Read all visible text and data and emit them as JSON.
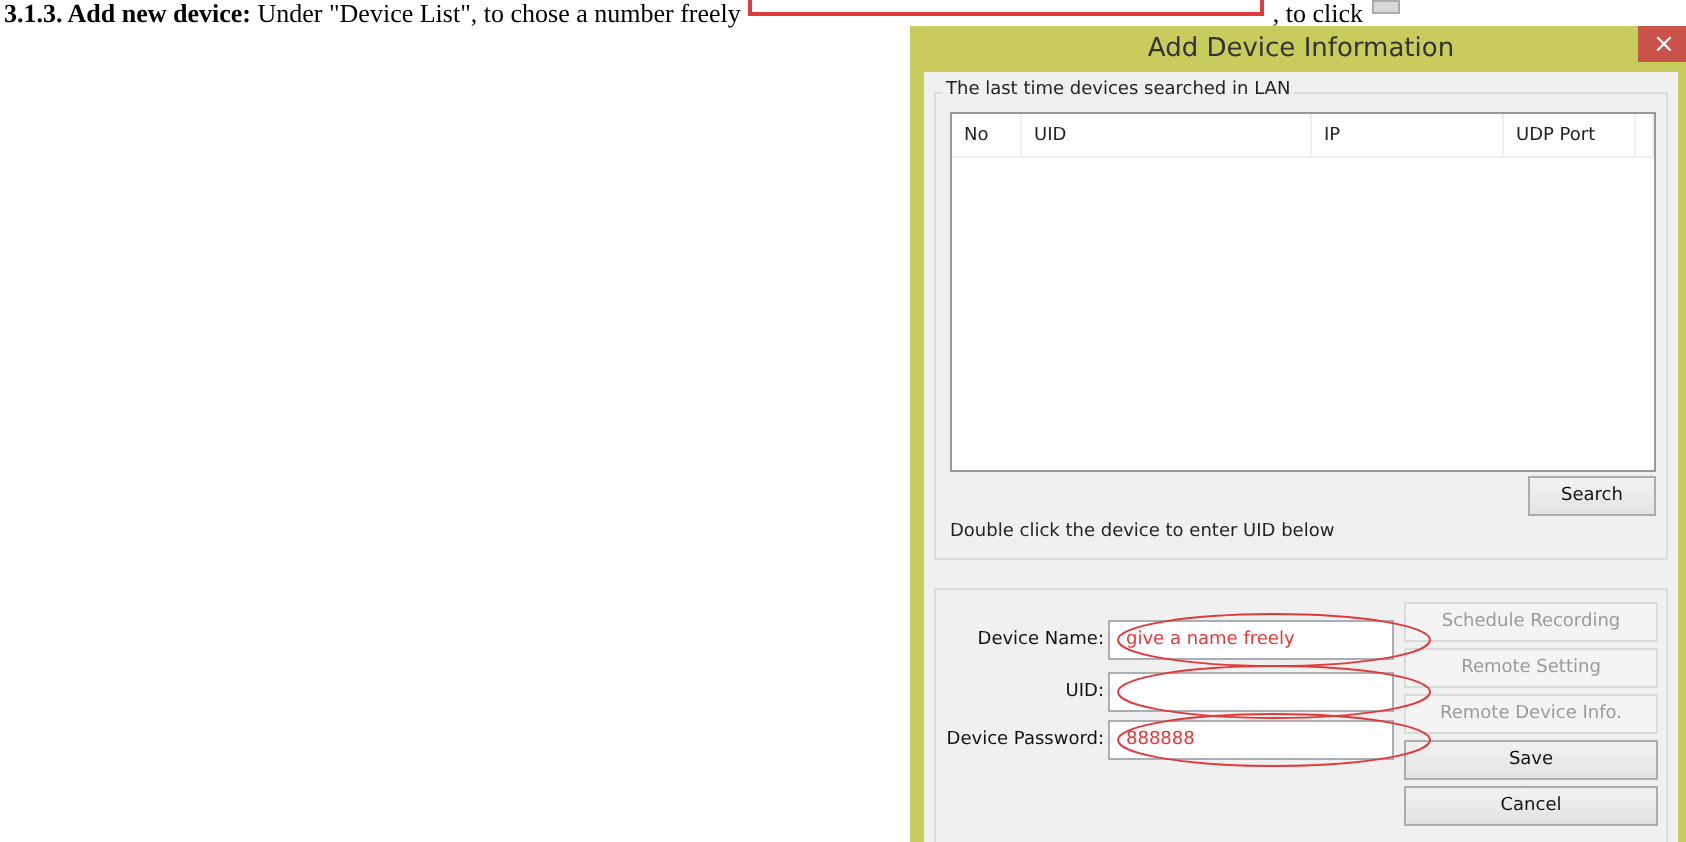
{
  "document": {
    "heading": "3.1.3. Add new device:",
    "text_before": "Under \"Device List\", to chose a number freely",
    "text_after": ", to click"
  },
  "window": {
    "title": "Add Device Information",
    "close": "×"
  },
  "search_group": {
    "title": "The last time devices searched in LAN",
    "table": {
      "columns": [
        "No",
        "UID",
        "IP",
        "UDP Port"
      ]
    },
    "search_button": "Search",
    "hint": "Double click the device to enter UID below"
  },
  "form": {
    "fields": [
      {
        "label": "Device Name:",
        "value": "give a name freely",
        "circled": true
      },
      {
        "label": "UID:",
        "circled": true
      },
      {
        "label": "Device Password:",
        "value": "888888",
        "circled": true
      }
    ],
    "buttons": [
      {
        "label": "Schedule Recording",
        "disabled": true
      },
      {
        "label": "Remote Setting",
        "disabled": true
      },
      {
        "label": "Remote Device Info.",
        "disabled": true
      },
      {
        "label": "Save",
        "disabled": false
      },
      {
        "label": "Cancel",
        "disabled": false
      }
    ]
  }
}
